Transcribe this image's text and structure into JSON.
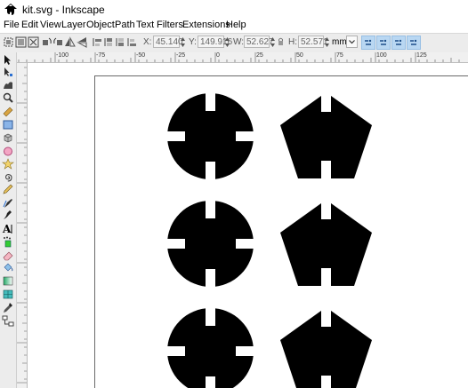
{
  "window": {
    "title": "kit.svg - Inkscape"
  },
  "menubar": {
    "items": [
      "File",
      "Edit",
      "View",
      "Layer",
      "Object",
      "Path",
      "Text",
      "Filters",
      "Extensions",
      "Help"
    ]
  },
  "tool_controls": {
    "x": {
      "label": "X:",
      "value": "45.140"
    },
    "y": {
      "label": "Y:",
      "value": "149.916"
    },
    "w": {
      "label": "W:",
      "value": "52.627"
    },
    "h": {
      "label": "H:",
      "value": "52.571"
    },
    "unit": "mm"
  },
  "ruler": {
    "top_labels": [
      "-100",
      "-75",
      "-50",
      "-25",
      "0",
      "25",
      "50",
      "75",
      "100",
      "125"
    ]
  },
  "canvas": {
    "shapes": [
      {
        "kind": "circle-cutout"
      },
      {
        "kind": "pentagon-cutout"
      },
      {
        "kind": "circle-cutout"
      },
      {
        "kind": "pentagon-cutout"
      },
      {
        "kind": "circle-cutout"
      },
      {
        "kind": "pentagon-cutout"
      }
    ]
  },
  "tools": [
    "selector-tool",
    "node-tool",
    "tweak-tool",
    "zoom-tool",
    "measure-tool",
    "rectangle-tool",
    "3d-box-tool",
    "ellipse-tool",
    "star-tool",
    "spiral-tool",
    "pencil-tool",
    "pen-tool",
    "calligraphy-tool",
    "text-tool",
    "spray-tool",
    "eraser-tool",
    "paint-bucket-tool",
    "gradient-tool",
    "mesh-tool",
    "dropper-tool",
    "connector-tool"
  ]
}
